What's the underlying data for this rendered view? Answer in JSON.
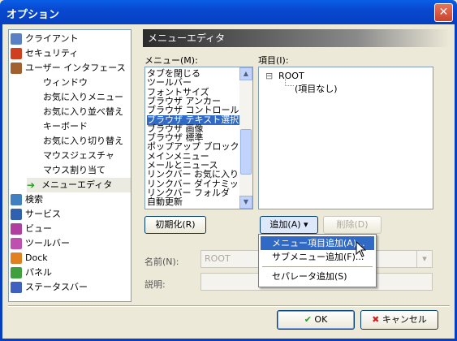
{
  "window": {
    "title": "オプション",
    "close_glyph": "✕"
  },
  "tree": {
    "items": [
      {
        "label": "クライアント",
        "icon": "client-icon",
        "color": "#5b7fc4"
      },
      {
        "label": "セキュリティ",
        "icon": "shield-icon",
        "color": "#d04020"
      },
      {
        "label": "ユーザー インタフェース",
        "icon": "users-icon",
        "color": "#a06030"
      },
      {
        "label": "ウィンドウ"
      },
      {
        "label": "お気に入りメニュー"
      },
      {
        "label": "お気に入り並べ替え"
      },
      {
        "label": "キーボード"
      },
      {
        "label": "お気に入り切り替え"
      },
      {
        "label": "マウスジェスチャ"
      },
      {
        "label": "マウス割り当て"
      },
      {
        "label": "メニューエディタ",
        "icon": "arrow-right-icon",
        "color": "#22a022",
        "selected": true
      },
      {
        "label": "検索",
        "icon": "search-icon",
        "color": "#4080c0"
      },
      {
        "label": "サービス",
        "icon": "service-icon",
        "color": "#3060b0"
      },
      {
        "label": "ビュー",
        "icon": "cube-icon",
        "color": "#b040a0"
      },
      {
        "label": "ツールバー",
        "icon": "cube-icon",
        "color": "#c050b0"
      },
      {
        "label": "Dock",
        "icon": "cube-icon",
        "color": "#e08020"
      },
      {
        "label": "パネル",
        "icon": "cube-icon",
        "color": "#40a040"
      },
      {
        "label": "ステータスバー",
        "icon": "cube-icon",
        "color": "#4060c0"
      }
    ]
  },
  "section_title": "メニューエディタ",
  "menu_label": "メニュー(M):",
  "item_label": "項目(I):",
  "menu_list": [
    "タブを閉じる",
    "ツールバー",
    "フォントサイズ",
    "ブラウザ アンカー",
    "ブラウザ コントロール",
    "ブラウザ テキスト選択",
    "ブラウザ 画像",
    "ブラウザ 標準",
    "ポップアップ ブロック",
    "メインメニュー",
    "メールとニュース",
    "リンクバー お気に入り",
    "リンクバー ダイナミック",
    "リンクバー フォルダ",
    "自動更新"
  ],
  "menu_selected": "ブラウザ テキスト選択",
  "item_tree": {
    "root": "ROOT",
    "child": "(項目なし)",
    "expander": "⊟"
  },
  "buttons": {
    "init": "初期化(R)",
    "add": "追加(A)",
    "add_arrow": "▾",
    "delete": "削除(D)",
    "ok": "OK",
    "cancel": "キャンセル"
  },
  "dropdown_menu": {
    "items": [
      "メニュー項目追加(A)...",
      "サブメニュー追加(F)...",
      "セパレータ追加(S)"
    ],
    "highlighted": "メニュー項目追加(A)..."
  },
  "name_label": "名前(N):",
  "name_value": "ROOT",
  "desc_label": "説明:",
  "desc_value": "",
  "colors": {
    "accent": "#316ac5",
    "titlebar": "#0848d0"
  }
}
